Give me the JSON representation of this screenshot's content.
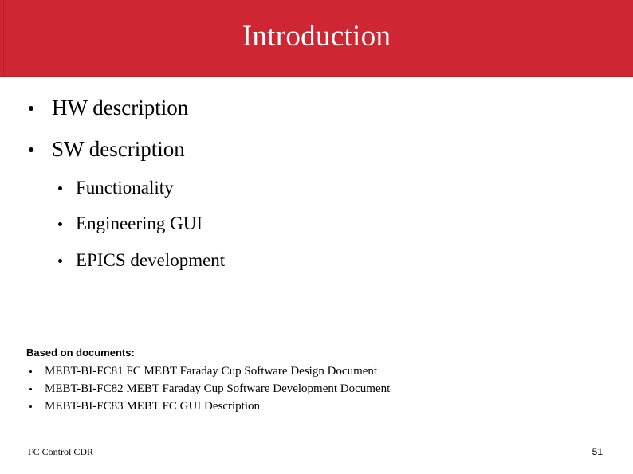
{
  "theme": {
    "band_color": "#ce2733",
    "title_color": "#ffffff",
    "text_color": "#000000",
    "background": "#ffffff"
  },
  "header": {
    "title": "Introduction"
  },
  "outline": {
    "level1": [
      {
        "label": "HW description"
      },
      {
        "label": "SW description"
      }
    ],
    "level2": [
      {
        "label": "Functionality"
      },
      {
        "label": "Engineering GUI"
      },
      {
        "label": "EPICS development"
      }
    ]
  },
  "documents": {
    "heading": "Based on documents:",
    "items": [
      {
        "label": "MEBT-BI-FC81 FC MEBT Faraday Cup Software Design Document"
      },
      {
        "label": "MEBT-BI-FC82 MEBT Faraday Cup Software Development Document"
      },
      {
        "label": "MEBT-BI-FC83 MEBT FC GUI Description"
      }
    ]
  },
  "footer": {
    "left_text": "FC Control CDR",
    "page_number": "51"
  }
}
